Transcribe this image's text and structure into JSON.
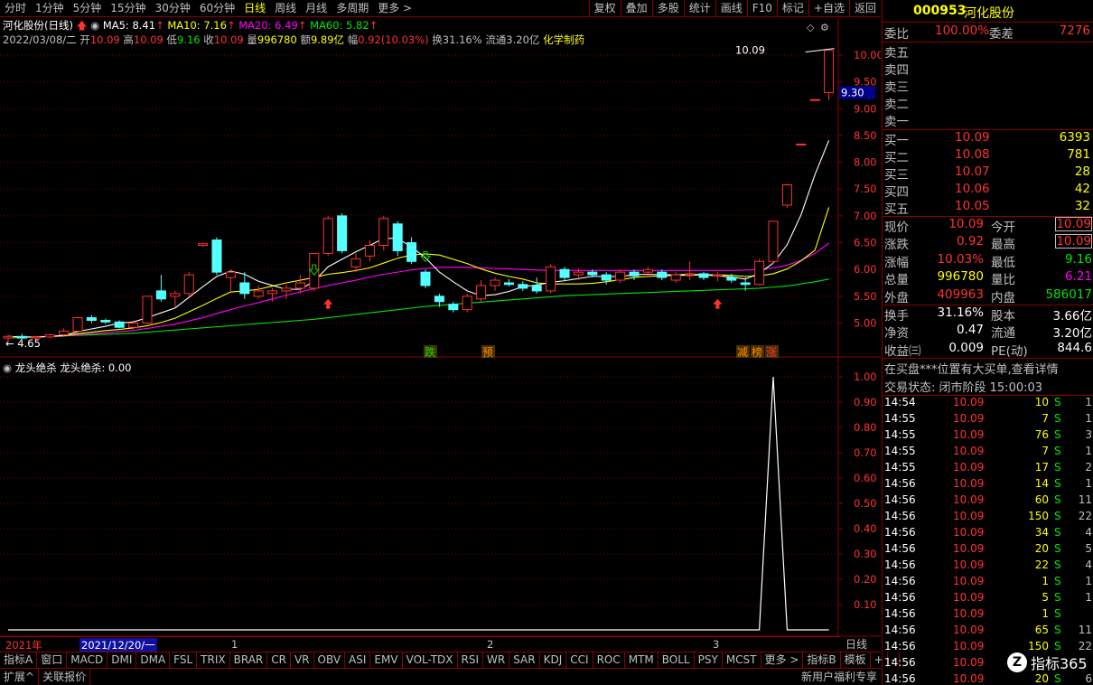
{
  "toolbar": {
    "timeframes": [
      "分时",
      "1分钟",
      "5分钟",
      "15分钟",
      "30分钟",
      "60分钟",
      "日线",
      "周线",
      "月线",
      "多周期",
      "更多 >"
    ],
    "active": "日线",
    "right_buttons": [
      "复权",
      "叠加",
      "多股",
      "统计",
      "画线",
      "F10",
      "标记",
      "+自选",
      "返回"
    ]
  },
  "info": {
    "name": "河化股份(日线)",
    "ma5": "MA5: 8.41",
    "ma10": "MA10: 7.16",
    "ma20": "MA20: 6.49",
    "ma60": "MA60: 5.82",
    "date": "2022/03/08/二",
    "open_label": "开",
    "open": "10.09",
    "high_label": "高",
    "high": "10.09",
    "low_label": "低",
    "low": "9.16",
    "close_label": "收",
    "close": "10.09",
    "vol_label": "量",
    "vol": "996780",
    "amt_label": "额",
    "amt": "9.89亿",
    "chg_label": "幅",
    "chg": "0.92(10.03%)",
    "turnover": "换31.16%",
    "float": "流通3.20亿",
    "industry": "化学制药"
  },
  "colors": {
    "ma5": "#ffffff",
    "ma10": "#ffff00",
    "ma20": "#ff00ff",
    "ma60": "#00e600",
    "up": "#ff3232",
    "down": "#54ffff",
    "border": "#8b0000"
  },
  "chart_data": {
    "type": "candlestick",
    "y_ticks": [
      "10.00",
      "9.50",
      "9.00",
      "8.50",
      "8.00",
      "7.50",
      "7.00",
      "6.50",
      "6.00",
      "5.50",
      "5.00"
    ],
    "current_price_tag": "9.30",
    "max_label": "10.09",
    "min_label": "4.65",
    "signals": [
      "跌",
      "预",
      "减",
      "榜",
      "涨"
    ],
    "ohlc": [
      [
        4.72,
        4.78,
        4.65,
        4.75
      ],
      [
        4.75,
        4.8,
        4.7,
        4.72
      ],
      [
        4.72,
        4.76,
        4.68,
        4.74
      ],
      [
        4.74,
        4.8,
        4.72,
        4.78
      ],
      [
        4.78,
        4.9,
        4.75,
        4.85
      ],
      [
        4.85,
        5.12,
        4.82,
        5.1
      ],
      [
        5.1,
        5.15,
        5.0,
        5.05
      ],
      [
        5.05,
        5.08,
        4.98,
        5.02
      ],
      [
        5.02,
        5.05,
        4.9,
        4.92
      ],
      [
        4.92,
        5.05,
        4.88,
        5.0
      ],
      [
        5.0,
        5.5,
        4.98,
        5.5
      ],
      [
        5.6,
        5.9,
        5.4,
        5.45
      ],
      [
        5.5,
        5.6,
        5.3,
        5.55
      ],
      [
        5.55,
        5.95,
        5.5,
        5.9
      ],
      [
        6.45,
        6.5,
        6.42,
        6.48
      ],
      [
        6.55,
        6.6,
        5.9,
        5.95
      ],
      [
        5.85,
        6.0,
        5.6,
        5.95
      ],
      [
        5.75,
        5.95,
        5.45,
        5.55
      ],
      [
        5.5,
        5.7,
        5.45,
        5.6
      ],
      [
        5.55,
        5.65,
        5.4,
        5.6
      ],
      [
        5.6,
        5.72,
        5.45,
        5.65
      ],
      [
        5.65,
        5.9,
        5.55,
        5.75
      ],
      [
        5.65,
        6.3,
        5.6,
        6.3
      ],
      [
        6.3,
        7.0,
        6.25,
        6.95
      ],
      [
        7.0,
        7.05,
        6.3,
        6.35
      ],
      [
        6.05,
        6.3,
        5.95,
        6.2
      ],
      [
        6.25,
        6.55,
        6.15,
        6.45
      ],
      [
        6.45,
        7.0,
        6.35,
        6.95
      ],
      [
        6.85,
        6.9,
        6.25,
        6.35
      ],
      [
        6.5,
        6.6,
        6.1,
        6.15
      ],
      [
        5.95,
        6.0,
        5.65,
        5.7
      ],
      [
        5.5,
        5.55,
        5.3,
        5.4
      ],
      [
        5.35,
        5.4,
        5.2,
        5.25
      ],
      [
        5.25,
        5.55,
        5.2,
        5.5
      ],
      [
        5.45,
        5.8,
        5.4,
        5.7
      ],
      [
        5.7,
        5.85,
        5.6,
        5.8
      ],
      [
        5.75,
        5.82,
        5.68,
        5.72
      ],
      [
        5.72,
        5.78,
        5.6,
        5.65
      ],
      [
        5.7,
        5.85,
        5.55,
        5.6
      ],
      [
        5.6,
        6.1,
        5.55,
        6.05
      ],
      [
        6.0,
        6.05,
        5.8,
        5.85
      ],
      [
        5.9,
        6.02,
        5.8,
        5.95
      ],
      [
        5.95,
        6.0,
        5.85,
        5.9
      ],
      [
        5.9,
        5.95,
        5.72,
        5.8
      ],
      [
        5.8,
        6.0,
        5.75,
        5.95
      ],
      [
        5.95,
        6.0,
        5.8,
        5.88
      ],
      [
        5.95,
        6.05,
        5.85,
        6.0
      ],
      [
        5.95,
        6.0,
        5.8,
        5.85
      ],
      [
        5.8,
        5.95,
        5.75,
        5.9
      ],
      [
        5.9,
        6.15,
        5.8,
        5.92
      ],
      [
        5.92,
        5.95,
        5.8,
        5.85
      ],
      [
        5.88,
        5.95,
        5.78,
        5.9
      ],
      [
        5.85,
        5.92,
        5.75,
        5.8
      ],
      [
        5.75,
        5.85,
        5.6,
        5.72
      ],
      [
        5.72,
        6.2,
        5.7,
        6.15
      ],
      [
        6.15,
        6.9,
        6.1,
        6.9
      ],
      [
        7.2,
        7.6,
        7.15,
        7.58
      ],
      [
        8.34,
        8.34,
        8.34,
        8.34
      ],
      [
        9.17,
        9.17,
        9.17,
        9.17
      ],
      [
        9.3,
        10.09,
        9.16,
        10.09
      ]
    ],
    "ma5": [
      4.75,
      4.74,
      4.74,
      4.75,
      4.77,
      4.84,
      4.89,
      4.94,
      5.0,
      5.02,
      5.1,
      5.19,
      5.28,
      5.48,
      5.68,
      5.87,
      5.97,
      5.91,
      5.78,
      5.7,
      5.63,
      5.63,
      5.78,
      6.05,
      6.19,
      6.33,
      6.45,
      6.58,
      6.58,
      6.42,
      6.22,
      5.95,
      5.77,
      5.6,
      5.51,
      5.53,
      5.59,
      5.68,
      5.71,
      5.76,
      5.79,
      5.83,
      5.87,
      5.87,
      5.87,
      5.9,
      5.91,
      5.9,
      5.9,
      5.91,
      5.9,
      5.88,
      5.86,
      5.82,
      5.93,
      6.12,
      6.46,
      7.02,
      7.77,
      8.41
    ],
    "ma10": [
      4.75,
      4.74,
      4.74,
      4.75,
      4.76,
      4.8,
      4.83,
      4.86,
      4.88,
      4.91,
      4.95,
      5.01,
      5.09,
      5.21,
      5.33,
      5.46,
      5.58,
      5.6,
      5.63,
      5.69,
      5.75,
      5.8,
      5.85,
      5.91,
      5.94,
      5.98,
      6.03,
      6.12,
      6.21,
      6.27,
      6.29,
      6.27,
      6.19,
      6.11,
      6.01,
      5.93,
      5.87,
      5.82,
      5.75,
      5.73,
      5.73,
      5.73,
      5.74,
      5.77,
      5.81,
      5.85,
      5.87,
      5.88,
      5.89,
      5.89,
      5.9,
      5.9,
      5.89,
      5.87,
      5.88,
      5.92,
      6.01,
      6.16,
      6.36,
      7.16
    ],
    "ma20": [
      4.75,
      4.74,
      4.74,
      4.75,
      4.76,
      4.78,
      4.8,
      4.82,
      4.84,
      4.86,
      4.9,
      4.94,
      4.98,
      5.04,
      5.1,
      5.18,
      5.25,
      5.32,
      5.38,
      5.45,
      5.52,
      5.58,
      5.64,
      5.7,
      5.75,
      5.8,
      5.86,
      5.91,
      5.95,
      5.99,
      6.02,
      6.04,
      6.04,
      6.04,
      6.03,
      6.02,
      6.01,
      6.0,
      5.99,
      5.98,
      5.98,
      5.98,
      5.98,
      5.98,
      5.98,
      5.98,
      5.98,
      5.98,
      5.98,
      5.98,
      5.98,
      5.98,
      5.98,
      5.99,
      6.0,
      6.03,
      6.08,
      6.17,
      6.3,
      6.49
    ],
    "ma60": [
      4.72,
      4.73,
      4.74,
      4.75,
      4.76,
      4.77,
      4.78,
      4.79,
      4.8,
      4.81,
      4.83,
      4.85,
      4.87,
      4.89,
      4.91,
      4.93,
      4.95,
      4.97,
      4.99,
      5.01,
      5.03,
      5.05,
      5.07,
      5.1,
      5.13,
      5.16,
      5.19,
      5.22,
      5.25,
      5.28,
      5.31,
      5.33,
      5.35,
      5.37,
      5.39,
      5.41,
      5.43,
      5.45,
      5.47,
      5.49,
      5.51,
      5.52,
      5.53,
      5.54,
      5.55,
      5.56,
      5.57,
      5.58,
      5.59,
      5.6,
      5.61,
      5.62,
      5.63,
      5.64,
      5.65,
      5.67,
      5.69,
      5.73,
      5.77,
      5.82
    ],
    "indicator": {
      "name": "龙头绝杀",
      "label": "龙头绝杀: 0.00",
      "y_ticks": [
        "1.00",
        "0.90",
        "0.80",
        "0.70",
        "0.60",
        "0.50",
        "0.40",
        "0.30",
        "0.20",
        "0.10"
      ],
      "values": [
        0,
        0,
        0,
        0,
        0,
        0,
        0,
        0,
        0,
        0,
        0,
        0,
        0,
        0,
        0,
        0,
        0,
        0,
        0,
        0,
        0,
        0,
        0,
        0,
        0,
        0,
        0,
        0,
        0,
        0,
        0,
        0,
        0,
        0,
        0,
        0,
        0,
        0,
        0,
        0,
        0,
        0,
        0,
        0,
        0,
        0,
        0,
        0,
        0,
        0,
        0,
        0,
        0,
        0,
        0,
        1,
        0,
        0,
        0,
        0
      ]
    },
    "time_labels": [
      "2021年",
      "2021/12/20/一",
      "1",
      "2",
      "3"
    ]
  },
  "tabs": [
    "指标A",
    "窗口",
    "MACD",
    "DMI",
    "DMA",
    "FSL",
    "TRIX",
    "BRAR",
    "CR",
    "VR",
    "OBV",
    "ASI",
    "EMV",
    "VOL-TDX",
    "RSI",
    "WR",
    "SAR",
    "KDJ",
    "CCI",
    "ROC",
    "MTM",
    "BOLL",
    "PSY",
    "MCST",
    "更多 >",
    "指标B",
    "模板",
    "+",
    "-"
  ],
  "bottom": [
    "扩展^",
    "关联报价"
  ],
  "bottom_right": "新用户福利专享",
  "period_label": "日线",
  "stock": {
    "code": "000953",
    "name": "河化股份",
    "weibi_label": "委比",
    "weibi": "100.00%",
    "weicha_label": "委差",
    "weicha": "7276",
    "sell_labels": [
      "卖五",
      "卖四",
      "卖三",
      "卖二",
      "卖一"
    ],
    "buys": [
      {
        "label": "买一",
        "price": "10.09",
        "vol": "6393"
      },
      {
        "label": "买二",
        "price": "10.08",
        "vol": "781"
      },
      {
        "label": "买三",
        "price": "10.07",
        "vol": "28"
      },
      {
        "label": "买四",
        "price": "10.06",
        "vol": "42"
      },
      {
        "label": "买五",
        "price": "10.05",
        "vol": "32"
      }
    ],
    "stats": [
      {
        "l1": "现价",
        "v1": "10.09",
        "l2": "今开",
        "v2": "10.09"
      },
      {
        "l1": "涨跌",
        "v1": "0.92",
        "l2": "最高",
        "v2": "10.09"
      },
      {
        "l1": "涨幅",
        "v1": "10.03%",
        "l2": "最低",
        "v2": "9.16"
      },
      {
        "l1": "总量",
        "v1": "996780",
        "l2": "量比",
        "v2": "6.21"
      },
      {
        "l1": "外盘",
        "v1": "409963",
        "l2": "内盘",
        "v2": "586017"
      }
    ],
    "stats2": [
      {
        "l1": "换手",
        "v1": "31.16%",
        "l2": "股本",
        "v2": "3.66亿"
      },
      {
        "l1": "净资",
        "v1": "0.47",
        "l2": "流通",
        "v2": "3.20亿"
      },
      {
        "l1": "收益㈢",
        "v1": "0.009",
        "l2": "PE(动)",
        "v2": "844.6"
      }
    ],
    "notice": "在买盘***位置有大买单,查看详情",
    "state": "交易状态: 闭市阶段 15:00:03",
    "ticks": [
      [
        "14:54",
        "10.09",
        "10",
        "S",
        "1"
      ],
      [
        "14:55",
        "10.09",
        "7",
        "S",
        "1"
      ],
      [
        "14:55",
        "10.09",
        "76",
        "S",
        "3"
      ],
      [
        "14:55",
        "10.09",
        "7",
        "S",
        "1"
      ],
      [
        "14:55",
        "10.09",
        "17",
        "S",
        "2"
      ],
      [
        "14:56",
        "10.09",
        "14",
        "S",
        "1"
      ],
      [
        "14:56",
        "10.09",
        "60",
        "S",
        "11"
      ],
      [
        "14:56",
        "10.09",
        "150",
        "S",
        "22"
      ],
      [
        "14:56",
        "10.09",
        "34",
        "S",
        "4"
      ],
      [
        "14:56",
        "10.09",
        "20",
        "S",
        "5"
      ],
      [
        "14:56",
        "10.09",
        "22",
        "S",
        "4"
      ],
      [
        "14:56",
        "10.09",
        "1",
        "S",
        "1"
      ],
      [
        "14:56",
        "10.09",
        "5",
        "S",
        "1"
      ],
      [
        "14:56",
        "10.09",
        "1",
        "S",
        ""
      ],
      [
        "14:56",
        "10.09",
        "65",
        "S",
        "11"
      ],
      [
        "14:56",
        "10.09",
        "150",
        "S",
        "22"
      ],
      [
        "14:56",
        "10.09",
        "",
        "",
        ""
      ],
      [
        "14:56",
        "10.09",
        "20",
        "S",
        "6"
      ]
    ],
    "watermark": "指标365"
  }
}
